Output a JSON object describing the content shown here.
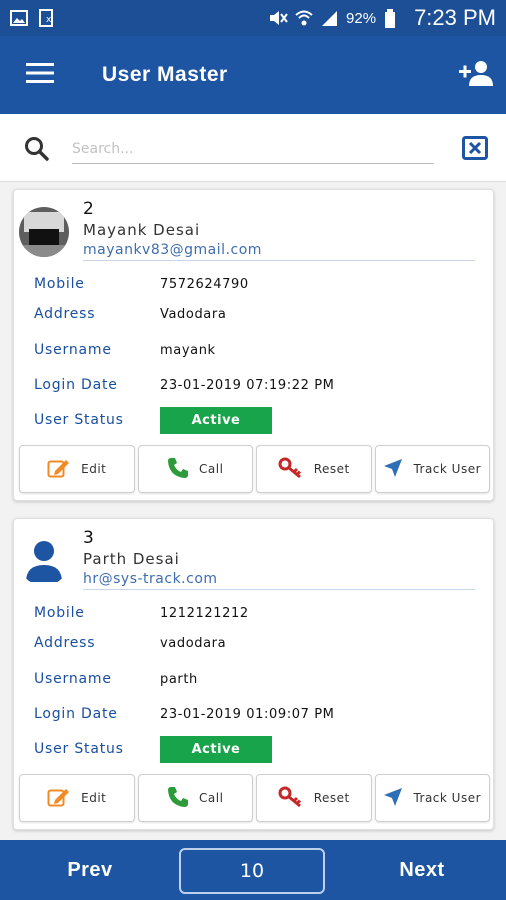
{
  "status_bar": {
    "battery_percent": "92%",
    "time": "7:23 PM",
    "icons": [
      "image-icon",
      "document-icon",
      "mute-icon",
      "wifi-icon",
      "signal-icon",
      "battery-icon"
    ]
  },
  "app_bar": {
    "title": "User Master",
    "menu_icon": "hamburger-menu-icon",
    "add_user_icon": "add-user-icon"
  },
  "search": {
    "placeholder": "Search...",
    "value": "",
    "clear_icon": "clear-search-icon"
  },
  "labels": {
    "mobile": "Mobile",
    "address": "Address",
    "username": "Username",
    "login_date": "Login Date",
    "user_status": "User Status"
  },
  "actions": {
    "edit": "Edit",
    "call": "Call",
    "reset": "Reset",
    "track": "Track User"
  },
  "users": [
    {
      "id": "2",
      "name": "Mayank Desai",
      "email": "mayankv83@gmail.com",
      "mobile": "7572624790",
      "address": "Vadodara",
      "username": "mayank",
      "login_date": "23-01-2019 07:19:22 PM",
      "status": "Active",
      "avatar": "photo-avatar"
    },
    {
      "id": "3",
      "name": "Parth Desai",
      "email": "hr@sys-track.com",
      "mobile": "1212121212",
      "address": "vadodara",
      "username": "parth",
      "login_date": "23-01-2019 01:09:07 PM",
      "status": "Active",
      "avatar": "default-person-avatar"
    }
  ],
  "pagination": {
    "prev": "Prev",
    "page_size": "10",
    "next": "Next"
  },
  "colors": {
    "primary": "#1d55a2",
    "status_bar": "#1d4f96",
    "label_blue": "#1a4fa0",
    "active_green": "#18a44a",
    "edit_orange": "#f08a24",
    "call_green": "#2e9b3a",
    "reset_red": "#c62828",
    "track_blue": "#2f6fb5"
  }
}
